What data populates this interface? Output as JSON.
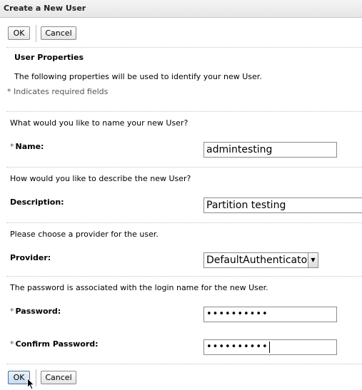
{
  "window": {
    "title": "Create a New User"
  },
  "toolbar": {
    "ok_label": "OK",
    "cancel_label": "Cancel"
  },
  "section": {
    "heading": "User Properties",
    "intro": "The following properties will be used to identify your new User.",
    "required_note": "* Indicates required fields"
  },
  "name_group": {
    "question": "What would you like to name your new User?",
    "label": "Name:",
    "value": "admintesting",
    "required": "*"
  },
  "description_group": {
    "question": "How would you like to describe the new User?",
    "label": "Description:",
    "value": "Partition testing"
  },
  "provider_group": {
    "question": "Please choose a provider for the user.",
    "label": "Provider:",
    "selected": "DefaultAuthenticator"
  },
  "password_group": {
    "question": "The password is associated with the login name for the new User.",
    "password_label": "Password:",
    "password_value": "••••••••••",
    "confirm_label": "Confirm Password:",
    "confirm_value": "••••••••••",
    "required": "*"
  },
  "bottom_bar": {
    "ok_label": "OK",
    "cancel_label": "Cancel"
  }
}
